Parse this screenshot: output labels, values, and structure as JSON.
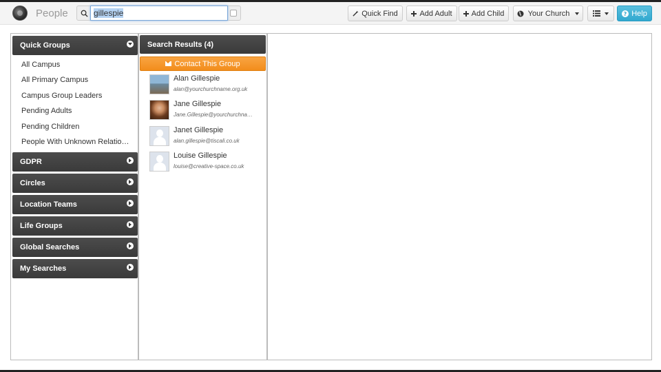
{
  "header": {
    "app_title": "People",
    "search_value": "gillespie",
    "buttons": {
      "quick_find": "Quick Find",
      "add_adult": "Add Adult",
      "add_child": "Add Child",
      "your_church": "Your Church",
      "help": "Help"
    }
  },
  "quick_groups": {
    "title": "Quick Groups",
    "items": [
      "All Campus",
      "All Primary Campus",
      "Campus Group Leaders",
      "Pending Adults",
      "Pending Children",
      "People With Unknown Relationships"
    ]
  },
  "groups": [
    "GDPR",
    "Circles",
    "Location Teams",
    "Life Groups",
    "Global Searches",
    "My Searches"
  ],
  "results": {
    "title": "Search Results (4)",
    "contact_label": "Contact This Group",
    "people": [
      {
        "name": "Alan Gillespie",
        "email": "alan@yourchurchname.org.uk"
      },
      {
        "name": "Jane Gillespie",
        "email": "Jane.Gillespie@yourchurchname.org.uk"
      },
      {
        "name": "Janet Gillespie",
        "email": "alan.gillespie@tiscali.co.uk"
      },
      {
        "name": "Louise Gillespie",
        "email": "louise@creative-space.co.uk"
      }
    ]
  }
}
